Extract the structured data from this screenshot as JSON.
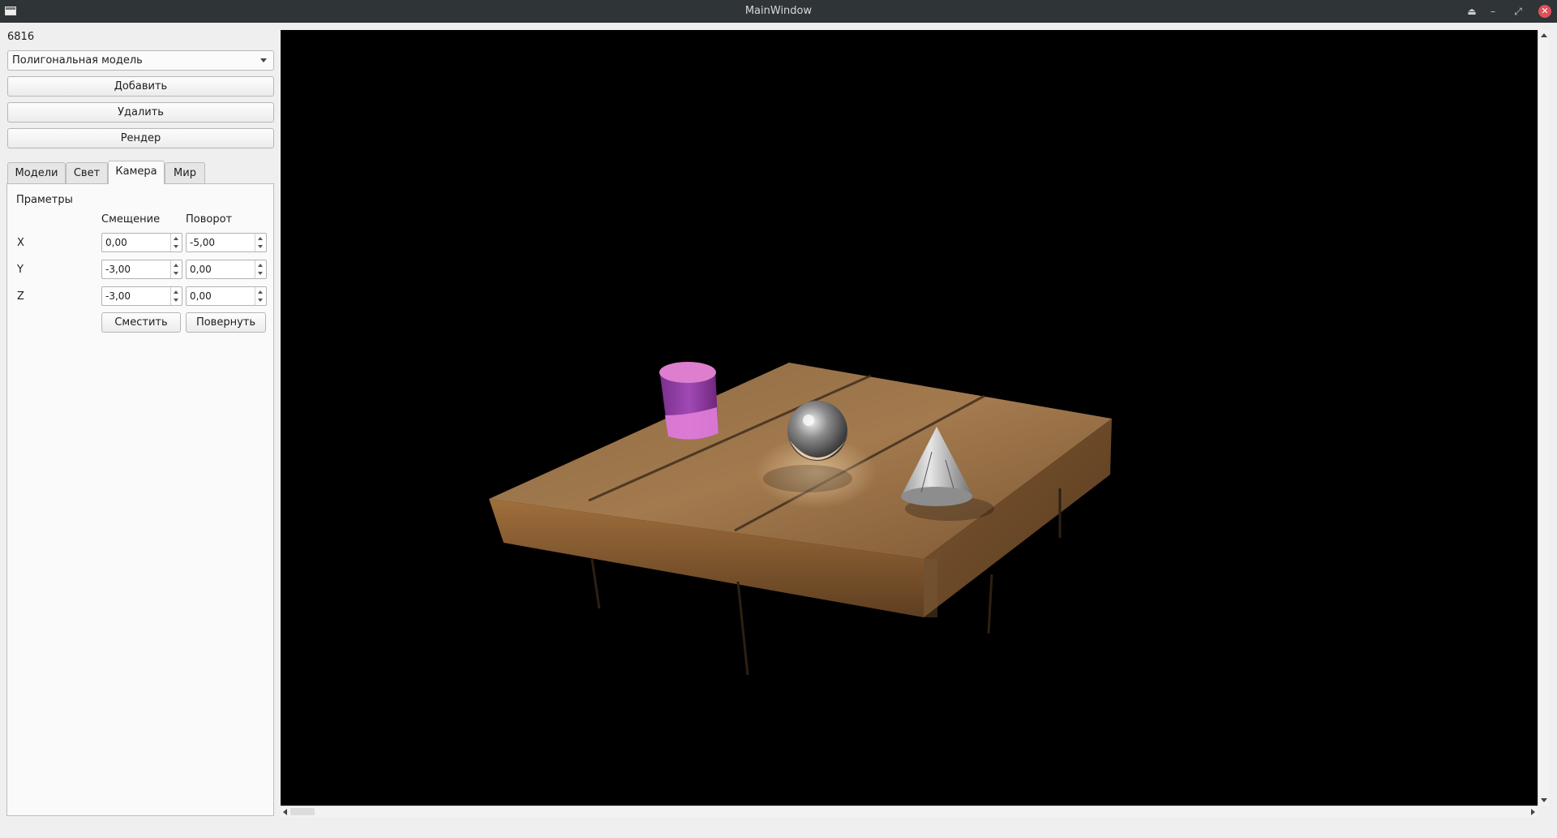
{
  "window": {
    "title": "MainWindow",
    "icons": [
      "app-window-icon",
      "eject-icon",
      "minimize-icon",
      "restore-icon",
      "close-icon"
    ]
  },
  "counter": "6816",
  "model_select": {
    "value": "Полигональная модель"
  },
  "buttons": {
    "add": "Добавить",
    "delete": "Удалить",
    "render": "Рендер"
  },
  "tabs": [
    {
      "label": "Модели"
    },
    {
      "label": "Свет"
    },
    {
      "label": "Камера"
    },
    {
      "label": "Мир"
    }
  ],
  "active_tab": "Камера",
  "camera": {
    "group_title": "Праметры",
    "offset_header": "Смещение",
    "rotation_header": "Поворот",
    "rows": [
      {
        "axis": "X",
        "offset": "0,00",
        "rotation": "-5,00"
      },
      {
        "axis": "Y",
        "offset": "-3,00",
        "rotation": "0,00"
      },
      {
        "axis": "Z",
        "offset": "-3,00",
        "rotation": "0,00"
      }
    ],
    "move_button": "Сместить",
    "rotate_button": "Повернуть"
  },
  "scene": {
    "objects": [
      "wooden-board",
      "pink-cylinder",
      "metal-sphere",
      "stone-cone"
    ],
    "colors": {
      "background": "#000000",
      "board": "#8a5f37",
      "cylinder": "#b36fc4",
      "sphere": "#9a9a9a",
      "cone": "#c8c8c8"
    }
  }
}
